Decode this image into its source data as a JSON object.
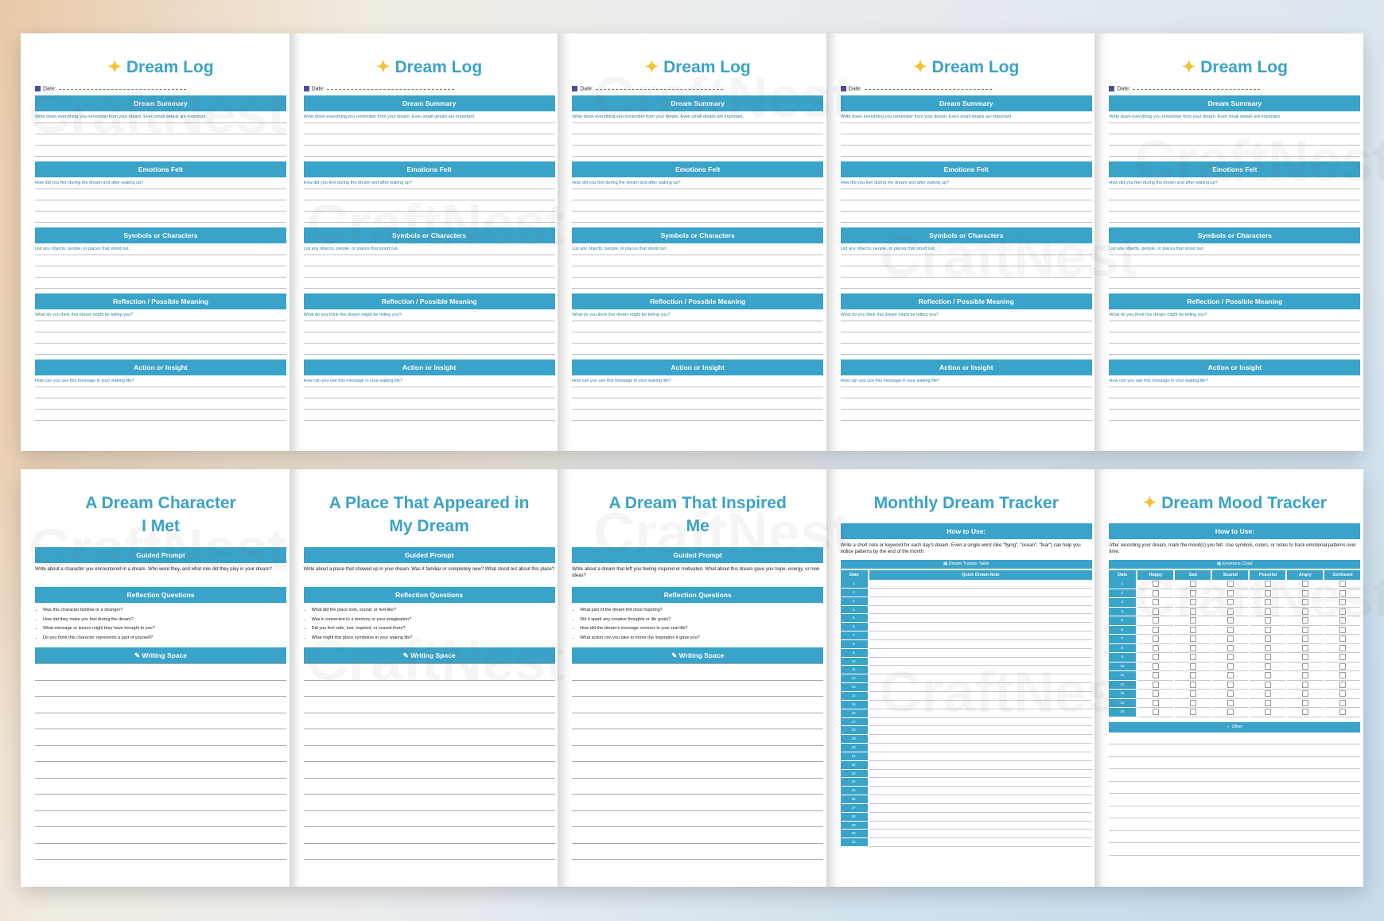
{
  "dream_log": {
    "title": "Dream Log",
    "date_label": "Date:",
    "sections": [
      {
        "label": "Dream Summary",
        "hint": "Write down everything you remember from your dream. Even small details are important."
      },
      {
        "label": "Emotions Felt",
        "hint": "How did you feel during the dream and after waking up?"
      },
      {
        "label": "Symbols or Characters",
        "hint": "List any objects, people, or places that stood out."
      },
      {
        "label": "Reflection / Possible Meaning",
        "hint": "What do you think this dream might be telling you?"
      },
      {
        "label": "Action or Insight",
        "hint": "How can you use this message in your waking life?"
      }
    ]
  },
  "prompt_pages": [
    {
      "title_line1": "A Dream Character",
      "title_line2": "I Met",
      "guided_label": "Guided Prompt",
      "prompt": "Write about a character you encountered in a dream. Who were they, and what role did they play in your dream?",
      "reflection_label": "Reflection Questions",
      "questions": [
        "Was this character familiar or a stranger?",
        "How did they make you feel during the dream?",
        "What message or lesson might they have brought to you?",
        "Do you think this character represents a part of yourself?"
      ],
      "writing_label": "Writing Space"
    },
    {
      "title_line1": "A Place That Appeared in",
      "title_line2": "My Dream",
      "guided_label": "Guided Prompt",
      "prompt": "Write about a place that showed up in your dream. Was it familiar or completely new? What stood out about this place?",
      "reflection_label": "Reflection Questions",
      "questions": [
        "What did the place look, sound, or feel like?",
        "Was it connected to a memory or your imagination?",
        "Did you feel safe, lost, inspired, or scared there?",
        "What might this place symbolize in your waking life?"
      ],
      "writing_label": "Writing Space"
    },
    {
      "title_line1": "A Dream That Inspired",
      "title_line2": "Me",
      "guided_label": "Guided Prompt",
      "prompt": "Write about a dream that left you feeling inspired or motivated. What about this dream gave you hope, energy, or new ideas?",
      "reflection_label": "Reflection Questions",
      "questions": [
        "What part of the dream felt most inspiring?",
        "Did it spark any creative thoughts or life goals?",
        "How did the dream's message connect to your real life?",
        "What action can you take to honor the inspiration it gave you?"
      ],
      "writing_label": "Writing Space"
    }
  ],
  "monthly": {
    "title": "Monthly Dream Tracker",
    "how_label": "How to Use:",
    "how_text": "Write a short note or keyword for each day's dream. Even a single word (like \"flying\", \"ocean\", \"fear\") can help you notice patterns by the end of the month.",
    "table_label": "Dream Tracker Table",
    "col_date": "Date",
    "col_note": "Quick Dream Note",
    "days": [
      "1.",
      "2.",
      "3.",
      "4.",
      "5.",
      "6.",
      "7.",
      "8.",
      "9.",
      "10.",
      "11.",
      "12.",
      "13.",
      "14.",
      "15.",
      "16.",
      "17.",
      "18.",
      "19.",
      "20.",
      "21.",
      "22.",
      "23.",
      "24.",
      "25.",
      "26.",
      "27.",
      "28.",
      "29.",
      "30.",
      "31."
    ]
  },
  "mood": {
    "title": "Dream Mood Tracker",
    "how_label": "How to Use:",
    "how_text": "After recording your dream, mark the mood(s) you felt. Use symbols, colors, or notes to track emotional patterns over time.",
    "chart_label": "Emotions Chart",
    "col_date": "Date",
    "moods": [
      "Happy",
      "Sad",
      "Scared",
      "Peaceful",
      "Angry",
      "Confused"
    ],
    "days": [
      "1.",
      "2.",
      "3.",
      "4.",
      "5.",
      "6.",
      "7.",
      "8.",
      "9.",
      "10.",
      "11.",
      "12.",
      "13.",
      "14.",
      "15."
    ],
    "other_label": "Other"
  },
  "watermark": "CraftNest",
  "colors": {
    "accent": "#3aa3c9",
    "star": "#f2c230"
  }
}
